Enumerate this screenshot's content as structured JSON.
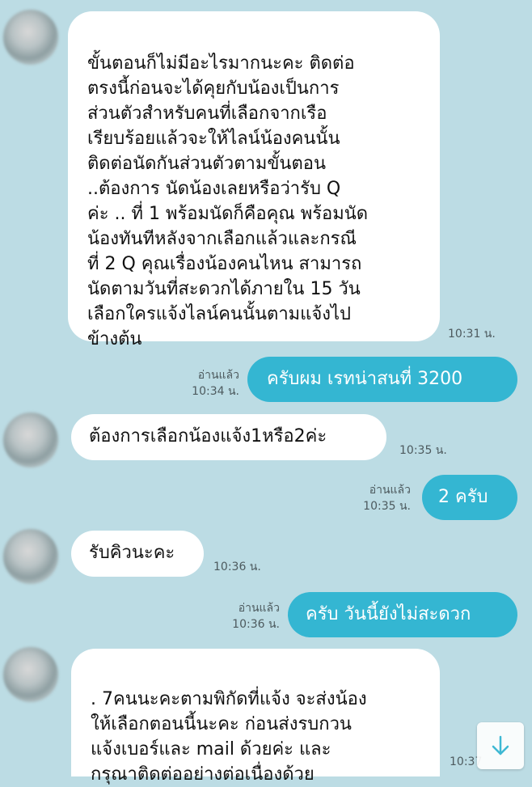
{
  "messages": [
    {
      "type": "incoming",
      "text": "ขั้นตอนก็ไม่มีอะไรมากนะคะ ติดต่อ\nตรงนี้ก่อนจะได้คุยกับน้องเป็นการ\nส่วนตัวสำหรับคนที่เลือกจากเรือ\nเรียบร้อยแล้วจะให้ไลน์น้องคนนั้น\nติดต่อนัดกันส่วนตัวตามขั้นตอน\n..ต้องการ นัดน้องเลยหรือว่ารับ Q\nค่ะ .. ที่ 1 พร้อมนัดก็คือคุณ พร้อมนัด\nน้องทันทีหลังจากเลือกแล้วและกรณี\nที่ 2 Q คุณเรื่องน้องคนไหน สามารถ\nนัดตามวันที่สะดวกได้ภายใน 15 วัน\nเลือกใครแจ้งไลน์คนนั้นตามแจ้งไป\nข้างต้น",
      "time": "10:31 น."
    },
    {
      "type": "outgoing",
      "text": "ครับผม เรทน่าสนที่ 3200",
      "read": "อ่านแล้ว",
      "time": "10:34 น."
    },
    {
      "type": "incoming",
      "text": "ต้องการเลือกน้องแจ้ง1หรือ2ค่ะ",
      "time": "10:35 น."
    },
    {
      "type": "outgoing",
      "text": "2 ครับ",
      "read": "อ่านแล้ว",
      "time": "10:35 น."
    },
    {
      "type": "incoming",
      "text": "รับคิวนะคะ",
      "time": "10:36 น."
    },
    {
      "type": "outgoing",
      "text": "ครับ วันนี้ยังไม่สะดวก",
      "read": "อ่านแล้ว",
      "time": "10:36 น."
    },
    {
      "type": "incoming",
      "text": ". 7คนนะคะตามพิกัดที่แจ้ง จะส่งน้อง\nให้เลือกตอนนี้นะคะ ก่อนส่งรบกวน\nแจ้งเบอร์และ mail ด้วยค่ะ และ\nกรุณาติดต่ออย่างต่อเนื่องด้วย",
      "time": "10:37"
    }
  ],
  "scroll_button": {
    "icon": "arrow-down-icon"
  },
  "colors": {
    "background": "#bcdce4",
    "outgoing_bubble": "#34b6d2",
    "incoming_bubble": "#ffffff",
    "scroll_arrow": "#34b6d2"
  }
}
